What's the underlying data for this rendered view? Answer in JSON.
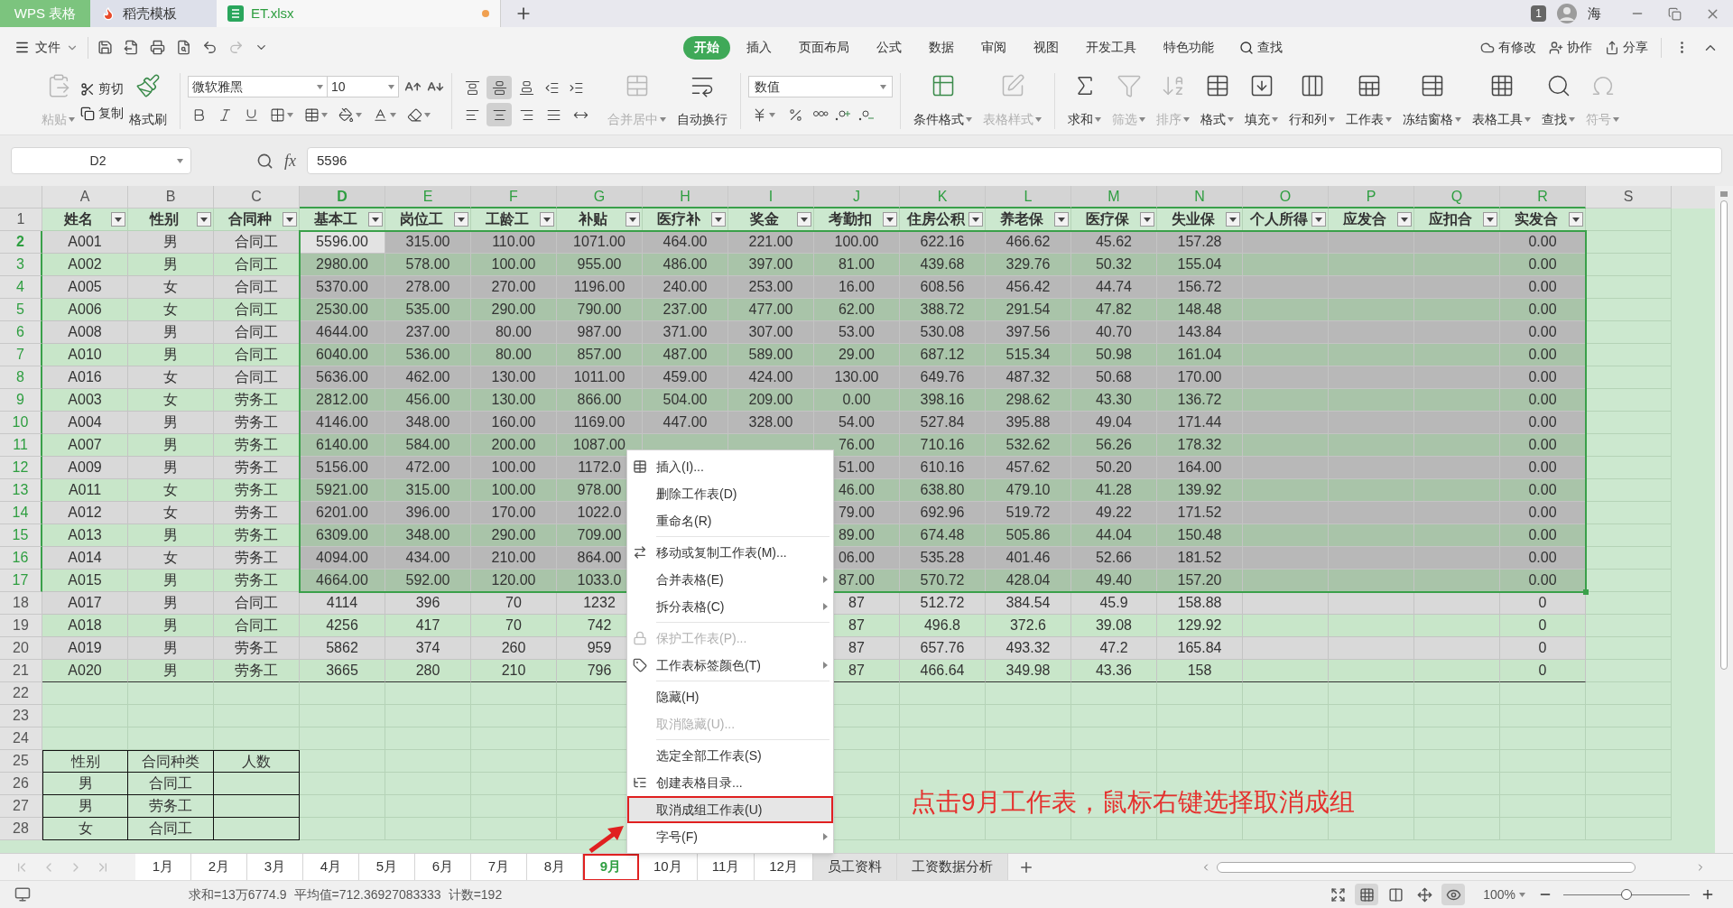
{
  "title_tabs": [
    {
      "label": "WPS 表格",
      "kind": "app",
      "selected": false
    },
    {
      "label": "稻壳模板",
      "kind": "template",
      "selected": false
    },
    {
      "label": "ET.xlsx",
      "kind": "file",
      "selected": true,
      "modified": true
    }
  ],
  "account": {
    "badge": "1",
    "user": "海"
  },
  "menu": {
    "file": "文件",
    "tabs": [
      {
        "label": "开始",
        "selected": true
      },
      {
        "label": "插入",
        "selected": false
      },
      {
        "label": "页面布局",
        "selected": false
      },
      {
        "label": "公式",
        "selected": false
      },
      {
        "label": "数据",
        "selected": false
      },
      {
        "label": "审阅",
        "selected": false
      },
      {
        "label": "视图",
        "selected": false
      },
      {
        "label": "开发工具",
        "selected": false
      },
      {
        "label": "特色功能",
        "selected": false
      }
    ],
    "search": "查找",
    "actions": [
      "有修改",
      "协作",
      "分享"
    ]
  },
  "ribbon": {
    "clipboard": {
      "paste": {
        "label": "粘贴",
        "disabled": true
      },
      "cut": "剪切",
      "copy": "复制",
      "format_painter": "格式刷"
    },
    "font": {
      "name": "微软雅黑",
      "size": "10"
    },
    "alignment": {
      "vertical": [
        {
          "selected": false
        },
        {
          "selected": true
        },
        {
          "selected": false
        }
      ],
      "horizontal": [
        {
          "selected": false
        },
        {
          "selected": true
        },
        {
          "selected": false
        },
        {
          "selected": false
        },
        {
          "selected": false
        }
      ],
      "merge": {
        "label": "合并居中",
        "disabled": true
      },
      "wrap": {
        "label": "自动换行",
        "disabled": false
      }
    },
    "number": {
      "format": "数值"
    },
    "styles": [
      {
        "label": "条件格式",
        "disabled": false
      },
      {
        "label": "表格样式",
        "disabled": true
      }
    ],
    "tools": [
      {
        "label": "求和",
        "disabled": false
      },
      {
        "label": "筛选",
        "disabled": true
      },
      {
        "label": "排序",
        "disabled": true
      },
      {
        "label": "格式",
        "disabled": false
      },
      {
        "label": "填充",
        "disabled": false
      },
      {
        "label": "行和列",
        "disabled": false
      },
      {
        "label": "工作表",
        "disabled": false
      },
      {
        "label": "冻结窗格",
        "disabled": false
      },
      {
        "label": "表格工具",
        "disabled": false
      },
      {
        "label": "查找",
        "disabled": false
      },
      {
        "label": "符号",
        "disabled": true
      }
    ]
  },
  "formula_bar": {
    "name_box": "D2",
    "fx": "fx",
    "value": "5596"
  },
  "sheet": {
    "columns": [
      {
        "letter": "A",
        "selected": false,
        "active": false
      },
      {
        "letter": "B",
        "selected": false,
        "active": false
      },
      {
        "letter": "C",
        "selected": false,
        "active": false
      },
      {
        "letter": "D",
        "selected": true,
        "active": true
      },
      {
        "letter": "E",
        "selected": true,
        "active": false
      },
      {
        "letter": "F",
        "selected": true,
        "active": false
      },
      {
        "letter": "G",
        "selected": true,
        "active": false
      },
      {
        "letter": "H",
        "selected": true,
        "active": false
      },
      {
        "letter": "I",
        "selected": true,
        "active": false
      },
      {
        "letter": "J",
        "selected": true,
        "active": false
      },
      {
        "letter": "K",
        "selected": true,
        "active": false
      },
      {
        "letter": "L",
        "selected": true,
        "active": false
      },
      {
        "letter": "M",
        "selected": true,
        "active": false
      },
      {
        "letter": "N",
        "selected": true,
        "active": false
      },
      {
        "letter": "O",
        "selected": true,
        "active": false
      },
      {
        "letter": "P",
        "selected": true,
        "active": false
      },
      {
        "letter": "Q",
        "selected": true,
        "active": false
      },
      {
        "letter": "R",
        "selected": true,
        "active": false
      },
      {
        "letter": "S",
        "selected": false,
        "active": false
      }
    ],
    "rows": [
      {
        "number": "1",
        "kind": "header",
        "selected": false,
        "active": false,
        "cells": [
          "姓名",
          "性别",
          "合同种",
          "基本工",
          "岗位工",
          "工龄工",
          "补贴",
          "医疗补",
          "奖金",
          "考勤扣",
          "住房公积",
          "养老保",
          "医疗保",
          "失业保",
          "个人所得",
          "应发合",
          "应扣合",
          "实发合"
        ]
      },
      {
        "number": "2",
        "kind": "data",
        "selected": true,
        "active": true,
        "cells": [
          "A001",
          "男",
          "合同工",
          "5596.00",
          "315.00",
          "110.00",
          "1071.00",
          "464.00",
          "221.00",
          "100.00",
          "622.16",
          "466.62",
          "45.62",
          "157.28",
          null,
          null,
          null,
          "0.00"
        ]
      },
      {
        "number": "3",
        "kind": "data",
        "selected": true,
        "active": false,
        "cells": [
          "A002",
          "男",
          "合同工",
          "2980.00",
          "578.00",
          "100.00",
          "955.00",
          "486.00",
          "397.00",
          "81.00",
          "439.68",
          "329.76",
          "50.32",
          "155.04",
          null,
          null,
          null,
          "0.00"
        ]
      },
      {
        "number": "4",
        "kind": "data",
        "selected": true,
        "active": false,
        "cells": [
          "A005",
          "女",
          "合同工",
          "5370.00",
          "278.00",
          "270.00",
          "1196.00",
          "240.00",
          "253.00",
          "16.00",
          "608.56",
          "456.42",
          "44.74",
          "156.72",
          null,
          null,
          null,
          "0.00"
        ]
      },
      {
        "number": "5",
        "kind": "data",
        "selected": true,
        "active": false,
        "cells": [
          "A006",
          "女",
          "合同工",
          "2530.00",
          "535.00",
          "290.00",
          "790.00",
          "237.00",
          "477.00",
          "62.00",
          "388.72",
          "291.54",
          "47.82",
          "148.48",
          null,
          null,
          null,
          "0.00"
        ]
      },
      {
        "number": "6",
        "kind": "data",
        "selected": true,
        "active": false,
        "cells": [
          "A008",
          "男",
          "合同工",
          "4644.00",
          "237.00",
          "80.00",
          "987.00",
          "371.00",
          "307.00",
          "53.00",
          "530.08",
          "397.56",
          "40.70",
          "143.84",
          null,
          null,
          null,
          "0.00"
        ]
      },
      {
        "number": "7",
        "kind": "data",
        "selected": true,
        "active": false,
        "cells": [
          "A010",
          "男",
          "合同工",
          "6040.00",
          "536.00",
          "80.00",
          "857.00",
          "487.00",
          "589.00",
          "29.00",
          "687.12",
          "515.34",
          "50.98",
          "161.04",
          null,
          null,
          null,
          "0.00"
        ]
      },
      {
        "number": "8",
        "kind": "data",
        "selected": true,
        "active": false,
        "cells": [
          "A016",
          "女",
          "合同工",
          "5636.00",
          "462.00",
          "130.00",
          "1011.00",
          "459.00",
          "424.00",
          "130.00",
          "649.76",
          "487.32",
          "50.68",
          "170.00",
          null,
          null,
          null,
          "0.00"
        ]
      },
      {
        "number": "9",
        "kind": "data",
        "selected": true,
        "active": false,
        "cells": [
          "A003",
          "女",
          "劳务工",
          "2812.00",
          "456.00",
          "130.00",
          "866.00",
          "504.00",
          "209.00",
          "0.00",
          "398.16",
          "298.62",
          "43.30",
          "136.72",
          null,
          null,
          null,
          "0.00"
        ]
      },
      {
        "number": "10",
        "kind": "data",
        "selected": true,
        "active": false,
        "cells": [
          "A004",
          "男",
          "劳务工",
          "4146.00",
          "348.00",
          "160.00",
          "1169.00",
          "447.00",
          "328.00",
          "54.00",
          "527.84",
          "395.88",
          "49.04",
          "171.44",
          null,
          null,
          null,
          "0.00"
        ]
      },
      {
        "number": "11",
        "kind": "data",
        "selected": true,
        "active": false,
        "cells": [
          "A007",
          "男",
          "劳务工",
          "6140.00",
          "584.00",
          "200.00",
          "1087.00",
          null,
          null,
          "76.00",
          "710.16",
          "532.62",
          "56.26",
          "178.32",
          null,
          null,
          null,
          "0.00"
        ]
      },
      {
        "number": "12",
        "kind": "data",
        "selected": true,
        "active": false,
        "cells": [
          "A009",
          "男",
          "劳务工",
          "5156.00",
          "472.00",
          "100.00",
          "1172.0",
          null,
          null,
          "51.00",
          "610.16",
          "457.62",
          "50.20",
          "164.00",
          null,
          null,
          null,
          "0.00"
        ]
      },
      {
        "number": "13",
        "kind": "data",
        "selected": true,
        "active": false,
        "cells": [
          "A011",
          "女",
          "劳务工",
          "5921.00",
          "315.00",
          "100.00",
          "978.00",
          null,
          null,
          "46.00",
          "638.80",
          "479.10",
          "41.28",
          "139.92",
          null,
          null,
          null,
          "0.00"
        ]
      },
      {
        "number": "14",
        "kind": "data",
        "selected": true,
        "active": false,
        "cells": [
          "A012",
          "女",
          "劳务工",
          "6201.00",
          "396.00",
          "170.00",
          "1022.0",
          null,
          null,
          "79.00",
          "692.96",
          "519.72",
          "49.22",
          "171.52",
          null,
          null,
          null,
          "0.00"
        ]
      },
      {
        "number": "15",
        "kind": "data",
        "selected": true,
        "active": false,
        "cells": [
          "A013",
          "男",
          "劳务工",
          "6309.00",
          "348.00",
          "290.00",
          "709.00",
          null,
          null,
          "89.00",
          "674.48",
          "505.86",
          "44.04",
          "150.48",
          null,
          null,
          null,
          "0.00"
        ]
      },
      {
        "number": "16",
        "kind": "data",
        "selected": true,
        "active": false,
        "cells": [
          "A014",
          "女",
          "劳务工",
          "4094.00",
          "434.00",
          "210.00",
          "864.00",
          null,
          null,
          "06.00",
          "535.28",
          "401.46",
          "52.66",
          "181.52",
          null,
          null,
          null,
          "0.00"
        ]
      },
      {
        "number": "17",
        "kind": "data",
        "selected": true,
        "active": false,
        "cells": [
          "A015",
          "男",
          "劳务工",
          "4664.00",
          "592.00",
          "120.00",
          "1033.0",
          null,
          null,
          "87.00",
          "570.72",
          "428.04",
          "49.40",
          "157.20",
          null,
          null,
          null,
          "0.00"
        ]
      },
      {
        "number": "18",
        "kind": "data",
        "selected": false,
        "active": false,
        "cells": [
          "A017",
          "男",
          "合同工",
          "4114",
          "396",
          "70",
          "1232",
          null,
          null,
          "87",
          "512.72",
          "384.54",
          "45.9",
          "158.88",
          null,
          null,
          null,
          "0"
        ]
      },
      {
        "number": "19",
        "kind": "data",
        "selected": false,
        "active": false,
        "cells": [
          "A018",
          "男",
          "合同工",
          "4256",
          "417",
          "70",
          "742",
          null,
          null,
          "87",
          "496.8",
          "372.6",
          "39.08",
          "129.92",
          null,
          null,
          null,
          "0"
        ]
      },
      {
        "number": "20",
        "kind": "data",
        "selected": false,
        "active": false,
        "cells": [
          "A019",
          "男",
          "劳务工",
          "5862",
          "374",
          "260",
          "959",
          null,
          null,
          "87",
          "657.76",
          "493.32",
          "47.2",
          "165.84",
          null,
          null,
          null,
          "0"
        ]
      },
      {
        "number": "21",
        "kind": "data",
        "selected": false,
        "active": false,
        "cells": [
          "A020",
          "男",
          "劳务工",
          "3665",
          "280",
          "210",
          "796",
          null,
          null,
          "87",
          "466.64",
          "349.98",
          "43.36",
          "158",
          null,
          null,
          null,
          "0"
        ]
      },
      {
        "number": "22",
        "kind": "blank",
        "selected": false,
        "active": false,
        "cells": []
      },
      {
        "number": "23",
        "kind": "blank",
        "selected": false,
        "active": false,
        "cells": []
      },
      {
        "number": "24",
        "kind": "blank",
        "selected": false,
        "active": false,
        "cells": []
      },
      {
        "number": "25",
        "kind": "boxed",
        "selected": false,
        "active": false,
        "cells": [
          "性别",
          "合同种类",
          "人数"
        ]
      },
      {
        "number": "26",
        "kind": "boxed",
        "selected": false,
        "active": false,
        "cells": [
          "男",
          "合同工",
          null
        ]
      },
      {
        "number": "27",
        "kind": "boxed",
        "selected": false,
        "active": false,
        "cells": [
          "男",
          "劳务工",
          null
        ]
      },
      {
        "number": "28",
        "kind": "boxed",
        "selected": false,
        "active": false,
        "cells": [
          "女",
          "合同工",
          null
        ]
      }
    ]
  },
  "context_menu": [
    {
      "kind": "icon",
      "label": "插入(I)...",
      "disabled": false,
      "submenu": false,
      "highlighted": false,
      "marked": false
    },
    {
      "kind": "plain",
      "label": "删除工作表(D)",
      "disabled": false,
      "submenu": false,
      "highlighted": false,
      "marked": false
    },
    {
      "kind": "plain",
      "label": "重命名(R)",
      "disabled": false,
      "submenu": false,
      "highlighted": false,
      "marked": false
    },
    {
      "kind": "separator"
    },
    {
      "kind": "icon",
      "label": "移动或复制工作表(M)...",
      "disabled": false,
      "submenu": false,
      "highlighted": false,
      "marked": false
    },
    {
      "kind": "plain",
      "label": "合并表格(E)",
      "disabled": false,
      "submenu": true,
      "highlighted": false,
      "marked": false
    },
    {
      "kind": "plain",
      "label": "拆分表格(C)",
      "disabled": false,
      "submenu": true,
      "highlighted": false,
      "marked": false
    },
    {
      "kind": "separator"
    },
    {
      "kind": "icon",
      "label": "保护工作表(P)...",
      "disabled": true,
      "submenu": false,
      "highlighted": false,
      "marked": false
    },
    {
      "kind": "icon",
      "label": "工作表标签颜色(T)",
      "disabled": false,
      "submenu": true,
      "highlighted": false,
      "marked": false
    },
    {
      "kind": "separator"
    },
    {
      "kind": "plain",
      "label": "隐藏(H)",
      "disabled": false,
      "submenu": false,
      "highlighted": false,
      "marked": false
    },
    {
      "kind": "plain",
      "label": "取消隐藏(U)...",
      "disabled": true,
      "submenu": false,
      "highlighted": false,
      "marked": false
    },
    {
      "kind": "separator"
    },
    {
      "kind": "plain",
      "label": "选定全部工作表(S)",
      "disabled": false,
      "submenu": false,
      "highlighted": false,
      "marked": false
    },
    {
      "kind": "icon",
      "label": "创建表格目录...",
      "disabled": false,
      "submenu": false,
      "highlighted": false,
      "marked": false
    },
    {
      "kind": "plain",
      "label": "取消成组工作表(U)",
      "disabled": false,
      "submenu": false,
      "highlighted": true,
      "marked": true
    },
    {
      "kind": "plain",
      "label": "字号(F)",
      "disabled": false,
      "submenu": true,
      "highlighted": false,
      "marked": false
    }
  ],
  "annotation": {
    "text": "点击9月工作表，鼠标右键选择取消成组"
  },
  "sheet_tabs": [
    {
      "label": "1月",
      "selected": false,
      "marked": false
    },
    {
      "label": "2月",
      "selected": false,
      "marked": false
    },
    {
      "label": "3月",
      "selected": false,
      "marked": false
    },
    {
      "label": "4月",
      "selected": false,
      "marked": false
    },
    {
      "label": "5月",
      "selected": false,
      "marked": false
    },
    {
      "label": "6月",
      "selected": false,
      "marked": false
    },
    {
      "label": "7月",
      "selected": false,
      "marked": false
    },
    {
      "label": "8月",
      "selected": false,
      "marked": false
    },
    {
      "label": "9月",
      "selected": true,
      "marked": true
    },
    {
      "label": "10月",
      "selected": false,
      "marked": false
    },
    {
      "label": "11月",
      "selected": false,
      "marked": false
    },
    {
      "label": "12月",
      "selected": false,
      "marked": false
    },
    {
      "label": "员工资料",
      "selected": false,
      "marked": false
    },
    {
      "label": "工资数据分析",
      "selected": false,
      "marked": false
    }
  ],
  "status_bar": {
    "sum": "求和=13万6774.9",
    "average": "平均值=712.36927083333",
    "count": "计数=192",
    "views": [
      {
        "selected": false
      },
      {
        "selected": true
      },
      {
        "selected": false
      },
      {
        "selected": false
      },
      {
        "selected": true
      }
    ],
    "zoom": "100%",
    "zoom_slider": {
      "level": 0.5
    }
  }
}
